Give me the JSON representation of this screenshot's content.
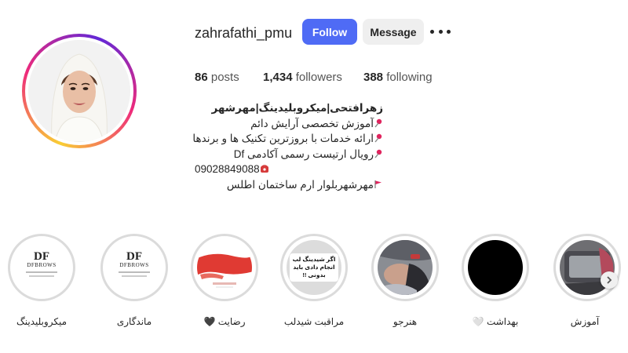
{
  "profile": {
    "username": "zahrafathi_pmu",
    "follow_label": "Follow",
    "message_label": "Message",
    "more_icon": "more-horizontal-icon"
  },
  "stats": {
    "posts_count": "86",
    "posts_label": "posts",
    "followers_count": "1,434",
    "followers_label": "followers",
    "following_count": "388",
    "following_label": "following"
  },
  "bio": {
    "name": "زهرافتحی|میکروبلیدینگ|مهرشهر",
    "lines": [
      "آموزش تخصصی آرایش دائم",
      "ارائه خدمات با بروزترین تکنیک ها و برندها",
      "رویال ارتیست رسمی آکادمی Df",
      "09028849088",
      "مهرشهربلوار ارم ساختمان اطلس"
    ]
  },
  "highlights": [
    {
      "label": "میکروبلیدینگ",
      "cover_text": "DF",
      "cover_sub": "DFBROWS"
    },
    {
      "label": "ماندگاری",
      "cover_text": "DF",
      "cover_sub": "DFBROWS"
    },
    {
      "label": "رضایت 🖤"
    },
    {
      "label": "مراقبت شیدلب",
      "cover_text": "اگر شیدینگ لب انجام دادی باید بدونی !!"
    },
    {
      "label": "هنرجو"
    },
    {
      "label": "بهداشت 🤍"
    },
    {
      "label": "آموزش"
    }
  ],
  "colors": {
    "follow_button": "#4f6bf5",
    "message_button": "#efefef",
    "text": "#262626"
  }
}
